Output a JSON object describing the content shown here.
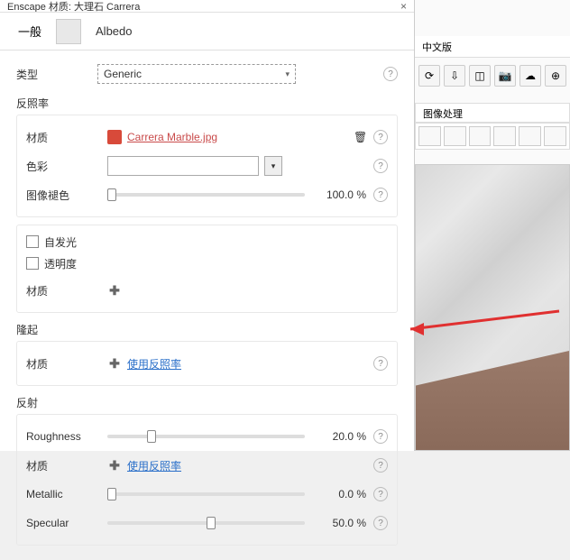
{
  "title_bar": "Enscape 材质: 大理石 Carrera",
  "tabs": {
    "general": "一般",
    "albedo": "Albedo"
  },
  "type": {
    "label": "类型",
    "value": "Generic"
  },
  "albedo_section": {
    "title": "反照率",
    "material_label": "材质",
    "material_file": "Carrera Marble.jpg",
    "color_label": "色彩",
    "tint_label": "图像褪色",
    "tint_value": "100.0 %"
  },
  "self_illum": "自发光",
  "transparency": "透明度",
  "material2_label": "材质",
  "bump": {
    "title": "隆起",
    "material_label": "材质",
    "link": "使用反照率"
  },
  "reflection": {
    "title": "反射",
    "roughness_label": "Roughness",
    "roughness_value": "20.0 %",
    "material_label": "材质",
    "material_link": "使用反照率",
    "metallic_label": "Metallic",
    "metallic_value": "0.0 %",
    "specular_label": "Specular",
    "specular_value": "50.0 %"
  },
  "right": {
    "header1": "中文版",
    "header2": "图像处理"
  }
}
